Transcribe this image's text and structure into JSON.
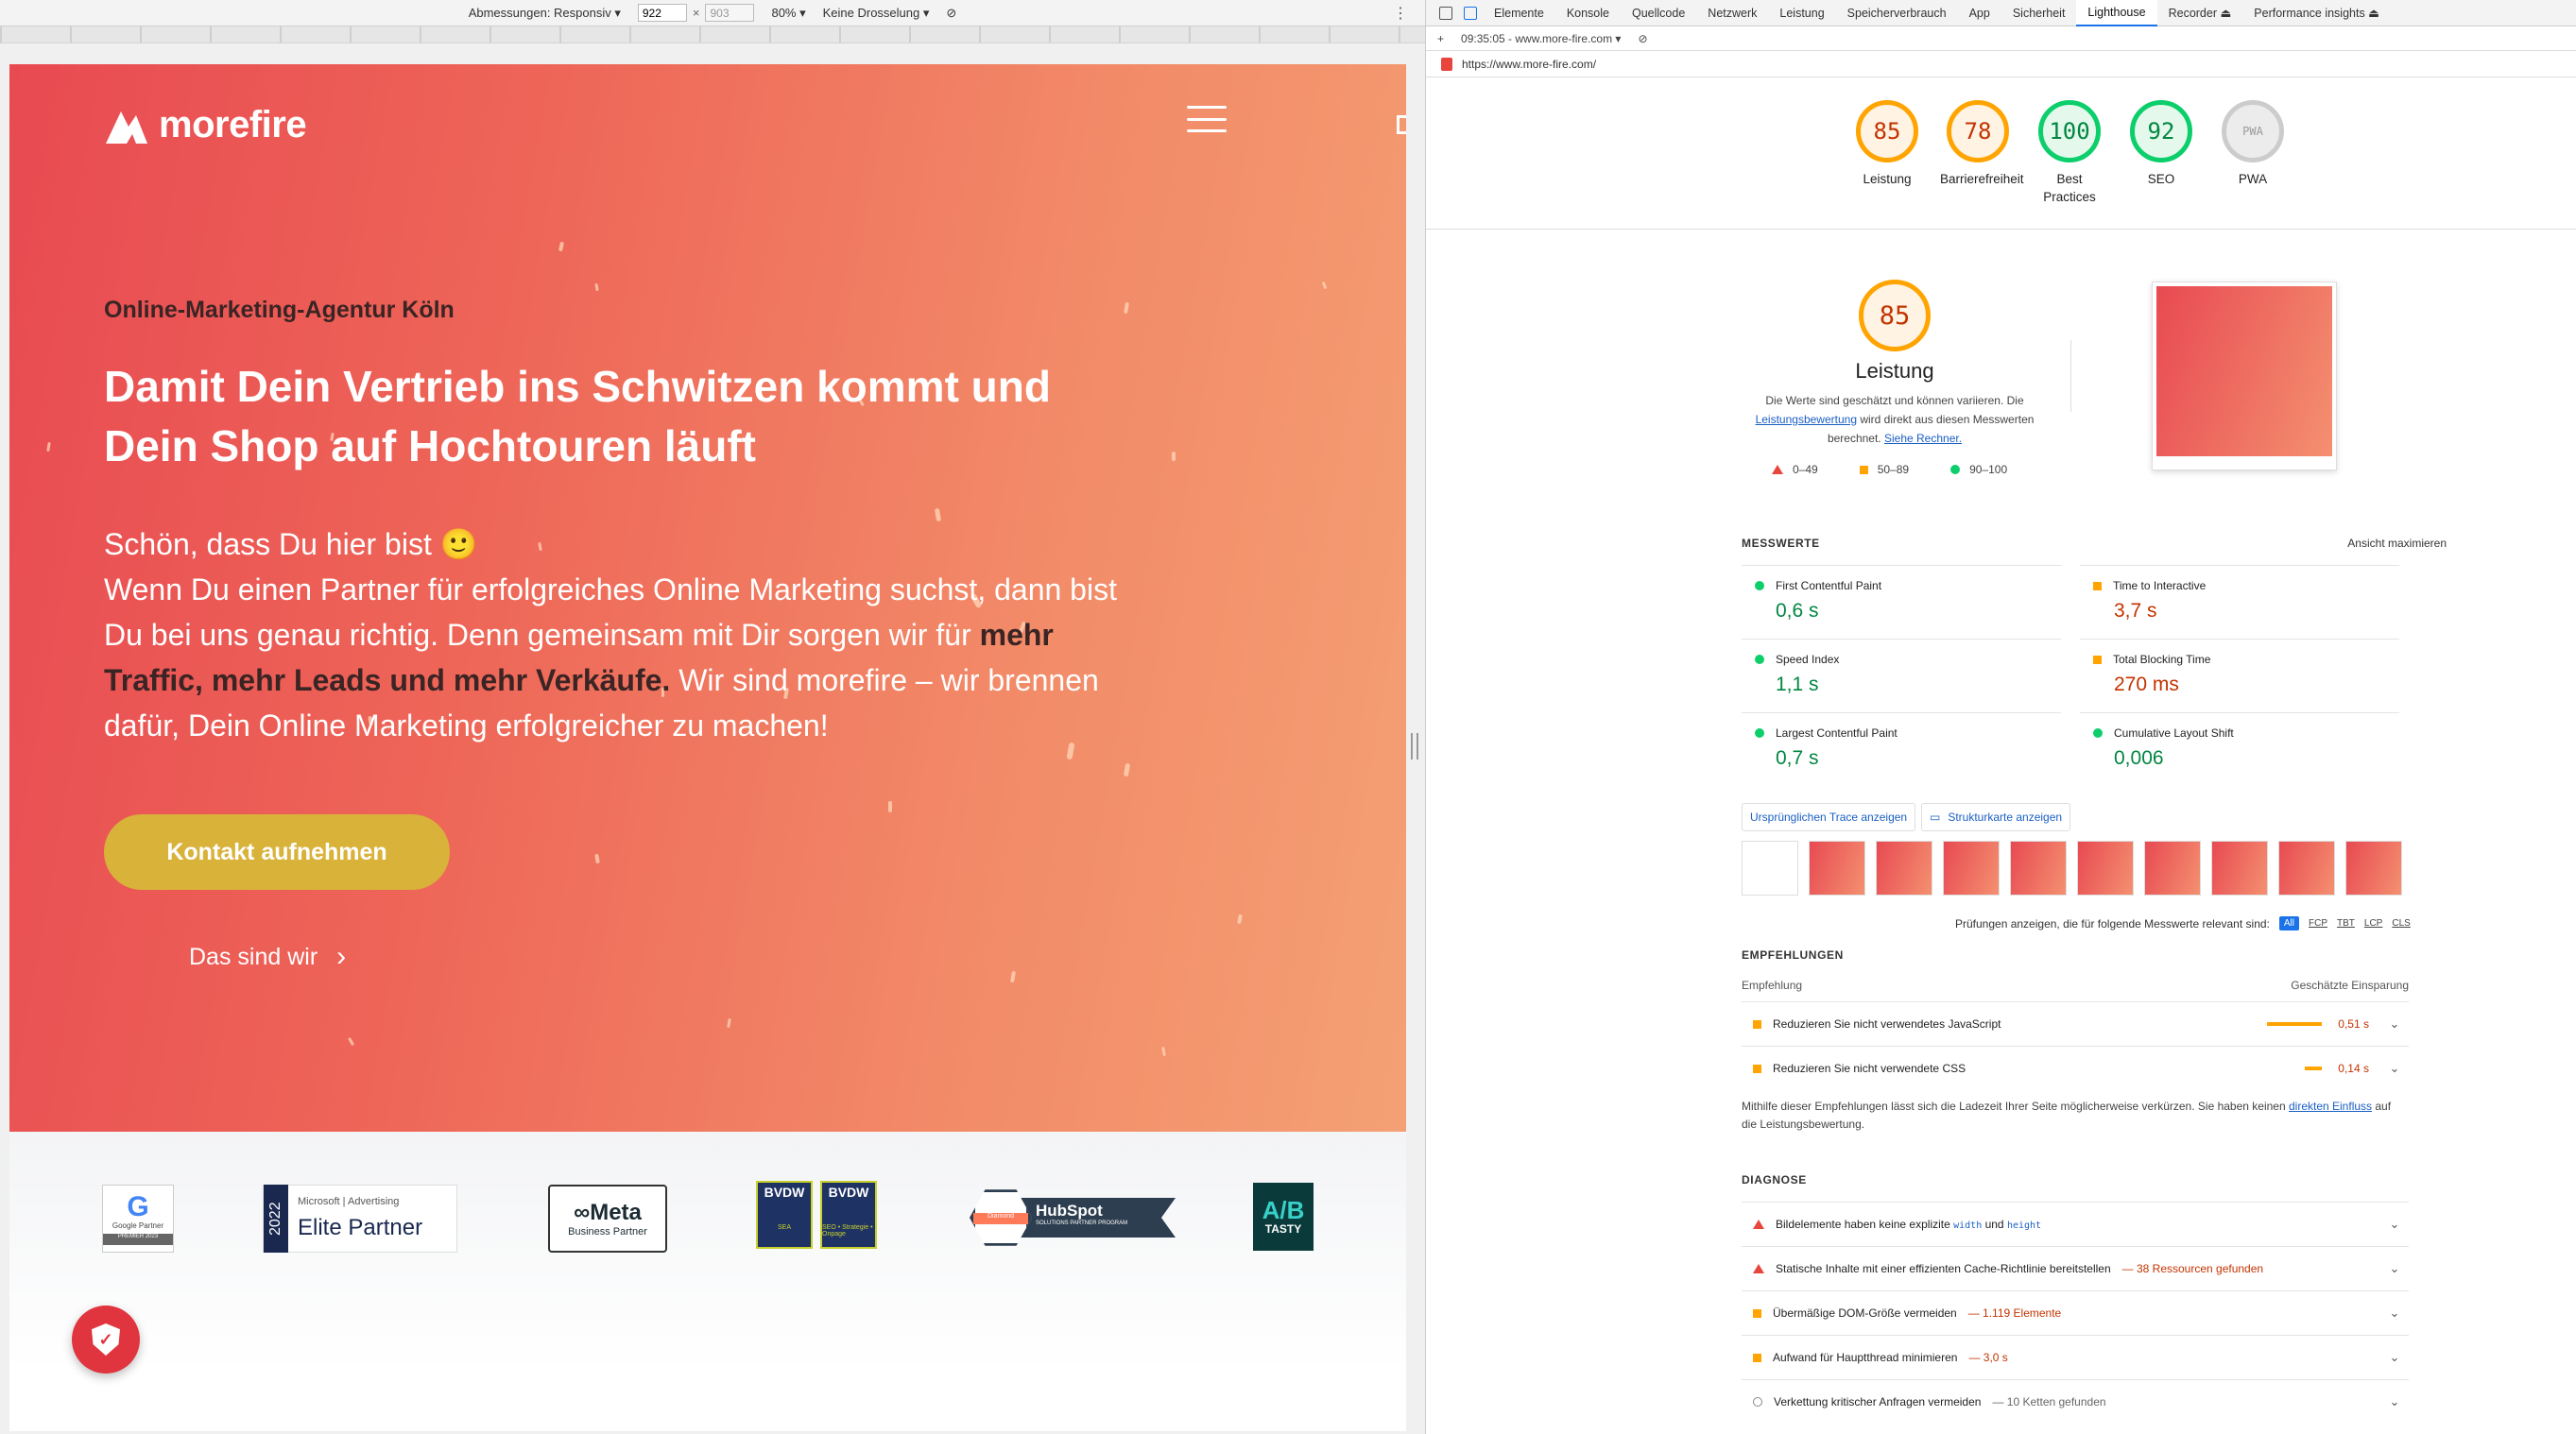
{
  "device_toolbar": {
    "dimensions_label": "Abmessungen: Responsiv ▾",
    "width": "922",
    "height": "903",
    "times": "×",
    "zoom": "80% ▾",
    "throttle": "Keine Drosselung ▾",
    "more": "⋮"
  },
  "site": {
    "logo_text": "morefire",
    "eyebrow": "Online-Marketing-Agentur Köln",
    "title": "Damit Dein Vertrieb ins Schwitzen kommt und Dein Shop auf Hochtouren läuft",
    "greeting": "Schön, dass Du hier bist 🙂",
    "text_1": "Wenn Du einen Partner für erfolgreiches Online Marketing suchst, dann bist Du bei uns genau richtig. Denn gemeinsam mit Dir sorgen wir für ",
    "text_bold": "mehr Traffic, mehr Leads und mehr Verkäufe.",
    "text_2": " Wir sind morefire – wir brennen dafür, Dein Online Marketing erfolgreicher zu machen!",
    "cta_label": "Kontakt aufnehmen",
    "about_label": "Das sind wir",
    "partners": {
      "google_g": "G",
      "google_line": "Google Partner",
      "google_band": "PREMIER 2023",
      "ms_year": "2022",
      "ms_small": "Microsoft | Advertising",
      "ms_big": "Elite Partner",
      "meta_big": "∞Meta",
      "meta_small": "Business Partner",
      "bvdw_1": "BVDW",
      "bvdw_1_sub": "SEA",
      "bvdw_2": "BVDW",
      "bvdw_2_sub": "SEO • Strategie • Onpage",
      "hubspot": "HubSpot",
      "hubspot_sub": "SOLUTIONS PARTNER PROGRAM",
      "hubspot_tier": "Diamond",
      "abtasty_1": "A/B",
      "abtasty_2": "TASTY"
    }
  },
  "devtools": {
    "tabs": [
      "Elemente",
      "Konsole",
      "Quellcode",
      "Netzwerk",
      "Leistung",
      "Speicherverbrauch",
      "App",
      "Sicherheit",
      "Lighthouse",
      "Recorder ⏏",
      "Performance insights ⏏"
    ],
    "active_tab": "Lighthouse",
    "report_time": "09:35:05 - www.more-fire.com ▾",
    "url": "https://www.more-fire.com/",
    "scores": [
      {
        "value": "85",
        "label": "Leistung",
        "status": "orange"
      },
      {
        "value": "78",
        "label": "Barrierefreiheit",
        "status": "orange"
      },
      {
        "value": "100",
        "label": "Best Practices",
        "status": "green"
      },
      {
        "value": "92",
        "label": "SEO",
        "status": "green"
      },
      {
        "value": "PWA",
        "label": "PWA",
        "status": "gray"
      }
    ],
    "perf": {
      "score": "85",
      "title": "Leistung",
      "desc_1": "Die Werte sind geschätzt und können variieren. Die ",
      "desc_link1": "Leistungsbewertung",
      "desc_2": " wird direkt aus diesen Messwerten berechnet. ",
      "desc_link2": "Siehe Rechner.",
      "legend": [
        "0–49",
        "50–89",
        "90–100"
      ]
    },
    "metrics_heading": "MESSWERTE",
    "metrics_expand": "Ansicht maximieren",
    "metrics": [
      {
        "name": "First Contentful Paint",
        "value": "0,6 s",
        "status": "green"
      },
      {
        "name": "Time to Interactive",
        "value": "3,7 s",
        "status": "orange"
      },
      {
        "name": "Speed Index",
        "value": "1,1 s",
        "status": "green"
      },
      {
        "name": "Total Blocking Time",
        "value": "270 ms",
        "status": "orange"
      },
      {
        "name": "Largest Contentful Paint",
        "value": "0,7 s",
        "status": "green"
      },
      {
        "name": "Cumulative Layout Shift",
        "value": "0,006",
        "status": "green"
      }
    ],
    "trace_button": "Ursprünglichen Trace anzeigen",
    "treemap_button": "Strukturkarte anzeigen",
    "filter_label": "Prüfungen anzeigen, die für folgende Messwerte relevant sind:",
    "filters": [
      "All",
      "FCP",
      "TBT",
      "LCP",
      "CLS"
    ],
    "recommendations_heading": "EMPFEHLUNGEN",
    "rec_col_left": "Empfehlung",
    "rec_col_right": "Geschätzte Einsparung",
    "recommendations": [
      {
        "title": "Reduzieren Sie nicht verwendetes JavaScript",
        "value": "0,51 s"
      },
      {
        "title": "Reduzieren Sie nicht verwendete CSS",
        "value": "0,14 s"
      }
    ],
    "rec_footer_1": "Mithilfe dieser Empfehlungen lässt sich die Ladezeit Ihrer Seite möglicherweise verkürzen. Sie haben keinen ",
    "rec_footer_link": "direkten Einfluss",
    "rec_footer_2": " auf die Leistungsbewertung.",
    "diagnostics_heading": "DIAGNOSE",
    "diag_1_a": "Bildelemente haben keine explizite ",
    "diag_1_code1": "width",
    "diag_1_b": " und ",
    "diag_1_code2": "height",
    "diag_2": "Statische Inhalte mit einer effizienten Cache-Richtlinie bereitstellen",
    "diag_2_detail": "— 38 Ressourcen gefunden",
    "diag_3": "Übermäßige DOM-Größe vermeiden",
    "diag_3_detail": "— 1.119 Elemente",
    "diag_4": "Aufwand für Hauptthread minimieren",
    "diag_4_detail": "— 3,0 s",
    "diag_5": "Verkettung kritischer Anfragen vermeiden",
    "diag_5_detail": "— 10 Ketten gefunden"
  }
}
